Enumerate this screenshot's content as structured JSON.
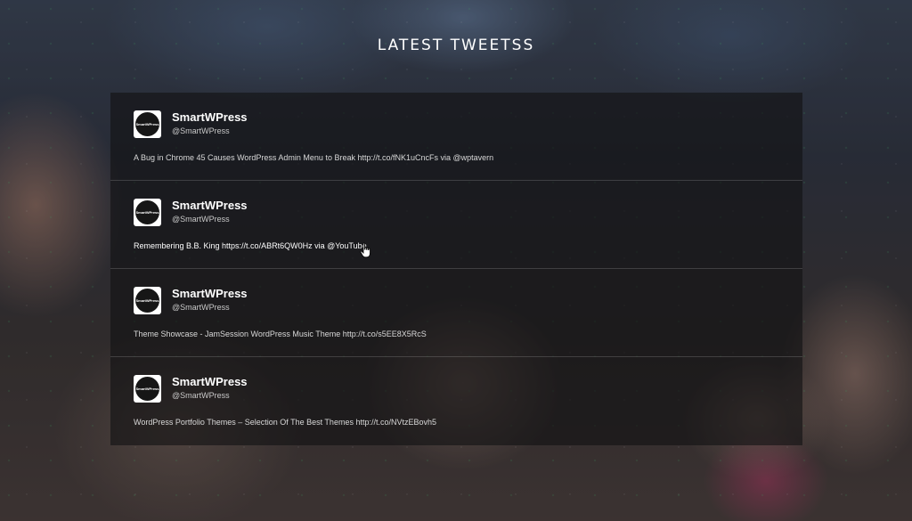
{
  "section": {
    "title": "LATEST TWEETSS"
  },
  "tweets": [
    {
      "avatar_text": "SmartWPress",
      "name": "SmartWPress",
      "handle": "@SmartWPress",
      "text": "A Bug in Chrome 45 Causes WordPress Admin Menu to Break http://t.co/fNK1uCncFs via @wptavern"
    },
    {
      "avatar_text": "SmartWPress",
      "name": "SmartWPress",
      "handle": "@SmartWPress",
      "text": "Remembering B.B. King https://t.co/ABRt6QW0Hz via @YouTube"
    },
    {
      "avatar_text": "SmartWPress",
      "name": "SmartWPress",
      "handle": "@SmartWPress",
      "text": "Theme Showcase - JamSession WordPress Music Theme http://t.co/s5EE8X5RcS"
    },
    {
      "avatar_text": "SmartWPress",
      "name": "SmartWPress",
      "handle": "@SmartWPress",
      "text": "WordPress Portfolio Themes – Selection Of The Best Themes http://t.co/NVtzEBovh5"
    }
  ],
  "icons": {
    "cursor": "hand-pointer-icon"
  }
}
